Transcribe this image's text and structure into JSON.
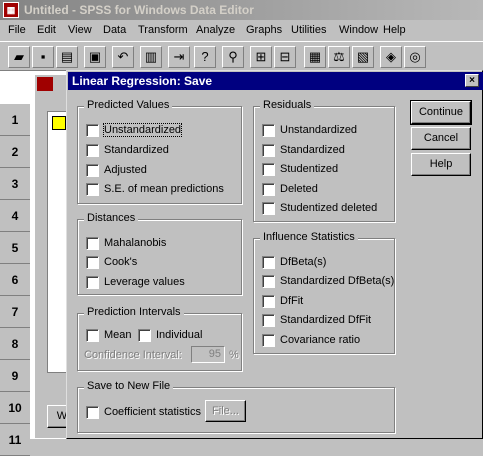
{
  "app": {
    "title": "Untitled - SPSS for Windows Data Editor"
  },
  "menu": [
    "File",
    "Edit",
    "View",
    "Data",
    "Transform",
    "Analyze",
    "Graphs",
    "Utilities",
    "Window",
    "Help"
  ],
  "row_headers": [
    "1",
    "2",
    "3",
    "4",
    "5",
    "6",
    "7",
    "8",
    "9",
    "10",
    "11"
  ],
  "child_button": "W",
  "dialog": {
    "title": "Linear Regression: Save",
    "close": "×",
    "predicted": {
      "title": "Predicted Values",
      "options": [
        "Unstandardized",
        "Standardized",
        "Adjusted",
        "S.E. of mean predictions"
      ]
    },
    "distances": {
      "title": "Distances",
      "options": [
        "Mahalanobis",
        "Cook's",
        "Leverage values"
      ]
    },
    "intervals": {
      "title": "Prediction Intervals",
      "mean": "Mean",
      "individual": "Individual",
      "ci_label": "Confidence Interval:",
      "ci_value": "95",
      "ci_unit": "%"
    },
    "residuals": {
      "title": "Residuals",
      "options": [
        "Unstandardized",
        "Standardized",
        "Studentized",
        "Deleted",
        "Studentized deleted"
      ]
    },
    "influence": {
      "title": "Influence Statistics",
      "options": [
        "DfBeta(s)",
        "Standardized DfBeta(s)",
        "DfFit",
        "Standardized DfFit",
        "Covariance ratio"
      ]
    },
    "save_file": {
      "title": "Save to New File",
      "coef": "Coefficient statistics",
      "file_button": "File..."
    },
    "buttons": {
      "continue": "Continue",
      "cancel": "Cancel",
      "help": "Help"
    }
  }
}
